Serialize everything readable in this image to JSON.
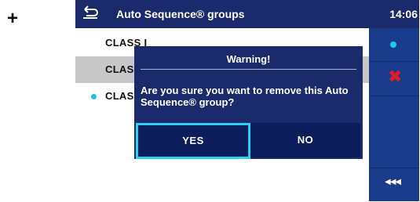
{
  "outside": {
    "plus": "+"
  },
  "header": {
    "title": "Auto Sequence® groups",
    "time": "14:06"
  },
  "list": {
    "items": [
      {
        "label": "CLASS I"
      },
      {
        "label": "CLASS II"
      },
      {
        "label": "CLASS III"
      }
    ]
  },
  "sidebar": {
    "buttons": [
      {
        "icon": "select-dot-icon"
      },
      {
        "icon": "delete-x-icon",
        "symbol": "✖"
      },
      {
        "icon": "back-arrows-icon",
        "symbol": "◀◀◀"
      }
    ]
  },
  "dialog": {
    "title": "Warning!",
    "message": "Are you sure you want to remove this Auto Sequence® group?",
    "yes_label": "YES",
    "no_label": "NO"
  },
  "colors": {
    "header_bg": "#1a2a6a",
    "sidebar_bg": "#1a3a8a",
    "accent_cyan": "#2ad0f0",
    "delete_red": "#e51b24",
    "selected_row": "#c8c8c8"
  }
}
